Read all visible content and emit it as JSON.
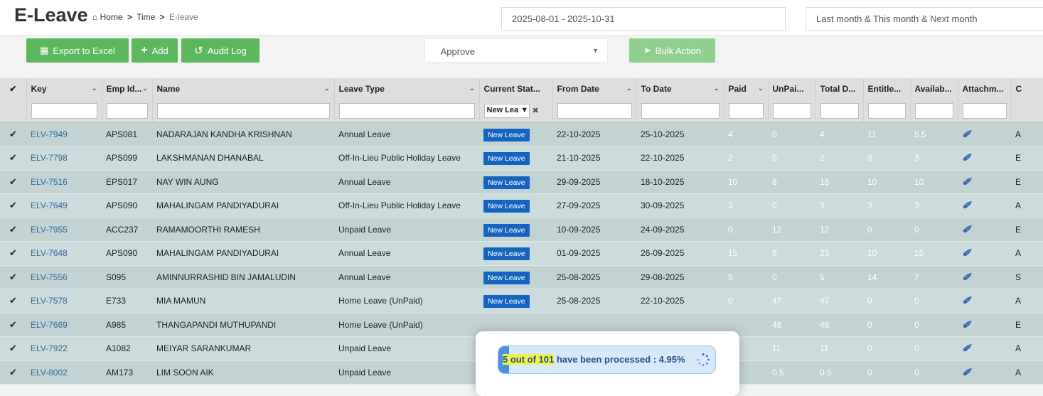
{
  "header": {
    "title": "E-Leave",
    "breadcrumb": {
      "home": "Home",
      "sep": ">",
      "section": "Time",
      "current": "E-leave"
    },
    "date_range": "2025-08-01 - 2025-10-31",
    "period": "Last month & This month & Next month"
  },
  "toolbar": {
    "export_label": "Export to Excel",
    "add_label": "Add",
    "audit_label": "Audit Log",
    "action_select": "Approve",
    "bulk_label": "Bulk Action"
  },
  "table": {
    "columns": [
      "Key",
      "Emp Id...",
      "Name",
      "Leave Type",
      "Current Stat...",
      "From Date",
      "To Date",
      "Paid",
      "UnPai...",
      "Total D...",
      "Entitle...",
      "Availab...",
      "Attachm...",
      "C"
    ],
    "status_filter": "New Lea",
    "rows": [
      {
        "key": "ELV-7949",
        "emp": "APS081",
        "name": "NADARAJAN KANDHA KRISHNAN",
        "type": "Annual Leave",
        "status": "New Leave",
        "from": "22-10-2025",
        "to": "25-10-2025",
        "paid": "4",
        "unpaid": "0",
        "total": "4",
        "ent": "11",
        "avail": "5.5",
        "last": "A"
      },
      {
        "key": "ELV-7798",
        "emp": "APS099",
        "name": "LAKSHMANAN DHANABAL",
        "type": "Off-In-Lieu Public Holiday Leave",
        "status": "New Leave",
        "from": "21-10-2025",
        "to": "22-10-2025",
        "paid": "2",
        "unpaid": "0",
        "total": "2",
        "ent": "3",
        "avail": "3",
        "last": "E"
      },
      {
        "key": "ELV-7516",
        "emp": "EPS017",
        "name": "NAY WIN AUNG",
        "type": "Annual Leave",
        "status": "New Leave",
        "from": "29-09-2025",
        "to": "18-10-2025",
        "paid": "10",
        "unpaid": "8",
        "total": "18",
        "ent": "10",
        "avail": "10",
        "last": "E"
      },
      {
        "key": "ELV-7649",
        "emp": "APS090",
        "name": "MAHALINGAM PANDIYADURAI",
        "type": "Off-In-Lieu Public Holiday Leave",
        "status": "New Leave",
        "from": "27-09-2025",
        "to": "30-09-2025",
        "paid": "3",
        "unpaid": "0",
        "total": "3",
        "ent": "3",
        "avail": "3",
        "last": "A"
      },
      {
        "key": "ELV-7955",
        "emp": "ACC237",
        "name": "RAMAMOORTHI RAMESH",
        "type": "Unpaid Leave",
        "status": "New Leave",
        "from": "10-09-2025",
        "to": "24-09-2025",
        "paid": "0",
        "unpaid": "12",
        "total": "12",
        "ent": "0",
        "avail": "0",
        "last": "E"
      },
      {
        "key": "ELV-7648",
        "emp": "APS090",
        "name": "MAHALINGAM PANDIYADURAI",
        "type": "Annual Leave",
        "status": "New Leave",
        "from": "01-09-2025",
        "to": "26-09-2025",
        "paid": "15",
        "unpaid": "8",
        "total": "23",
        "ent": "10",
        "avail": "15",
        "last": "A"
      },
      {
        "key": "ELV-7556",
        "emp": "S095",
        "name": "AMINNURRASHID BIN JAMALUDIN",
        "type": "Annual Leave",
        "status": "New Leave",
        "from": "25-08-2025",
        "to": "29-08-2025",
        "paid": "5",
        "unpaid": "0",
        "total": "5",
        "ent": "14",
        "avail": "7",
        "last": "S"
      },
      {
        "key": "ELV-7578",
        "emp": "E733",
        "name": "MIA MAMUN",
        "type": "Home Leave (UnPaid)",
        "status": "New Leave",
        "from": "25-08-2025",
        "to": "22-10-2025",
        "paid": "0",
        "unpaid": "47",
        "total": "47",
        "ent": "0",
        "avail": "0",
        "last": "A"
      },
      {
        "key": "ELV-7669",
        "emp": "A985",
        "name": "THANGAPANDI MUTHUPANDI",
        "type": "Home Leave (UnPaid)",
        "status": "",
        "from": "",
        "to": "",
        "paid": "",
        "unpaid": "48",
        "total": "48",
        "ent": "0",
        "avail": "0",
        "last": "E"
      },
      {
        "key": "ELV-7922",
        "emp": "A1082",
        "name": "MEIYAR SARANKUMAR",
        "type": "Unpaid Leave",
        "status": "",
        "from": "",
        "to": "",
        "paid": "",
        "unpaid": "11",
        "total": "11",
        "ent": "0",
        "avail": "0",
        "last": "A"
      },
      {
        "key": "ELV-8002",
        "emp": "AM173",
        "name": "LIM SOON AIK",
        "type": "Unpaid Leave",
        "status": "",
        "from": "",
        "to": "",
        "paid": "",
        "unpaid": "0.5",
        "total": "0.5",
        "ent": "0",
        "avail": "0",
        "last": "A"
      }
    ]
  },
  "progress": {
    "highlight": "5 out of 101",
    "rest": " have been processed : 4.95%",
    "fraction": 0.0495
  },
  "colors": {
    "accent_green": "#5cb85c",
    "badge_blue": "#1565c0",
    "link_blue": "#2f6f9f"
  }
}
